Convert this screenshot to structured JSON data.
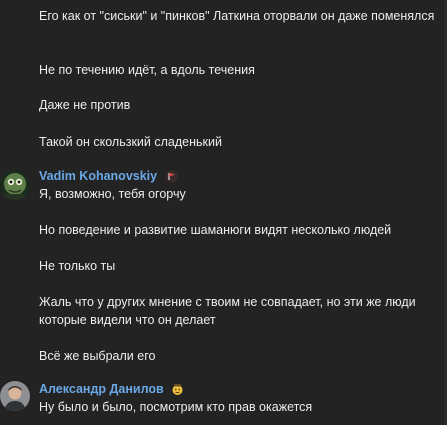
{
  "colors": {
    "background": "#232323",
    "text": "#ededed",
    "author_name": "#6aa8e6"
  },
  "messages_top": [
    "Его как от \"сиськи\" и \"пинков\" Латкина оторвали он даже поменялся",
    "Не по течению идёт, а вдоль течения",
    "Даже не против",
    "Такой он скользкий сладенький"
  ],
  "user1": {
    "name": "Vadim Kohanovskiy",
    "badge_icon": "flag-badge-icon",
    "avatar_icon": "green-creature-avatar"
  },
  "user1_messages": [
    "Я, возможно, тебя огорчу",
    "Но поведение и развитие шаманюги видят несколько людей",
    "Не только ты",
    "Жаль что у других мнение с твоим не совпадает, но эти же люди которые видели что он делает",
    "Всё же выбрали его"
  ],
  "user2": {
    "name": "Александр Данилов",
    "badge_icon": "emoji-badge-icon",
    "avatar_icon": "person-photo-avatar"
  },
  "user2_messages": [
    "Ну было и было, посмотрим кто прав окажется"
  ]
}
